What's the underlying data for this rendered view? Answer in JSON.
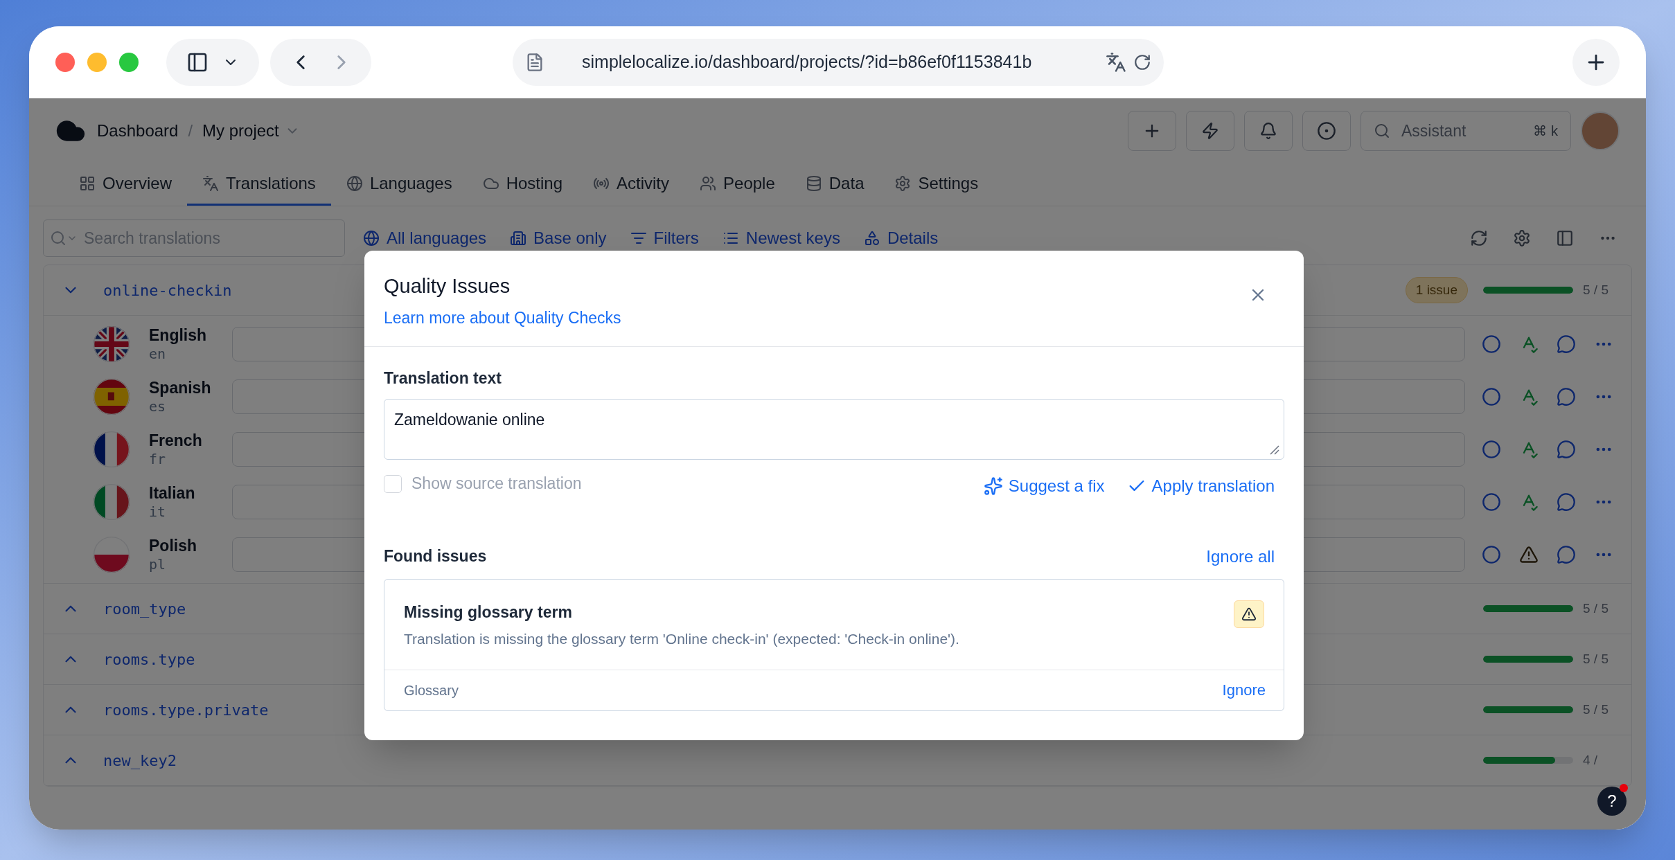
{
  "browser": {
    "url": "simplelocalize.io/dashboard/projects/?id=b86ef0f1153841b"
  },
  "header": {
    "breadcrumb": [
      {
        "label": "Dashboard"
      },
      {
        "label": "My project"
      }
    ],
    "separator": "/",
    "assistant": {
      "placeholder": "Assistant",
      "shortcut": "⌘ k"
    }
  },
  "tabs": [
    {
      "label": "Overview",
      "selected": false,
      "kind": "overview"
    },
    {
      "label": "Translations",
      "selected": true,
      "kind": "translations"
    },
    {
      "label": "Languages",
      "selected": false,
      "kind": "languages"
    },
    {
      "label": "Hosting",
      "selected": false,
      "kind": "hosting"
    },
    {
      "label": "Activity",
      "selected": false,
      "kind": "activity"
    },
    {
      "label": "People",
      "selected": false,
      "kind": "people"
    },
    {
      "label": "Data",
      "selected": false,
      "kind": "data"
    },
    {
      "label": "Settings",
      "selected": false,
      "kind": "settings"
    }
  ],
  "toolbar": {
    "search": {
      "placeholder": "Search translations"
    },
    "filters": [
      {
        "label": "All languages",
        "kind": "globe"
      },
      {
        "label": "Base only",
        "kind": "building"
      },
      {
        "label": "Filters",
        "kind": "filter"
      },
      {
        "label": "Newest keys",
        "kind": "sort"
      },
      {
        "label": "Details",
        "kind": "shapes"
      }
    ]
  },
  "keys": [
    {
      "key": "online-checkin",
      "expanded": true,
      "badge": "1 issue",
      "level": 1,
      "count": "5 / 5",
      "languages": [
        {
          "name": "English",
          "code": "en",
          "kind": "gb",
          "quality_issue": false
        },
        {
          "name": "Spanish",
          "code": "es",
          "kind": "es",
          "quality_issue": false
        },
        {
          "name": "French",
          "code": "fr",
          "kind": "fr",
          "quality_issue": false
        },
        {
          "name": "Italian",
          "code": "it",
          "kind": "it",
          "quality_issue": false
        },
        {
          "name": "Polish",
          "code": "pl",
          "kind": "pl",
          "quality_issue": true
        }
      ]
    },
    {
      "key": "room_type",
      "expanded": false,
      "level": 1,
      "count": "5 / 5"
    },
    {
      "key": "rooms.type",
      "expanded": false,
      "level": 1,
      "count": "5 / 5"
    },
    {
      "key": "rooms.type.private",
      "expanded": false,
      "level": 1,
      "count": "5 / 5"
    },
    {
      "key": "new_key2",
      "expanded": false,
      "level": 0.8,
      "count": "4 /"
    }
  ],
  "help": {
    "label": "?",
    "notification": true
  },
  "dialog": {
    "title": "Quality Issues",
    "link": "Learn more about Quality Checks",
    "field_label": "Translation text",
    "value": "Zameldowanie online",
    "checkbox": {
      "label": "Show source translation",
      "checked": false,
      "disabled": true
    },
    "actions": [
      {
        "label": "Suggest a fix",
        "kind": "sparkle"
      },
      {
        "label": "Apply translation",
        "kind": "check"
      }
    ],
    "issues_title": "Found issues",
    "ignore_all": "Ignore all",
    "issues": [
      {
        "title": "Missing glossary term",
        "description": "Translation is missing the glossary term 'Online check-in' (expected: 'Check-in online').",
        "category": "Glossary",
        "action": "Ignore"
      }
    ]
  }
}
